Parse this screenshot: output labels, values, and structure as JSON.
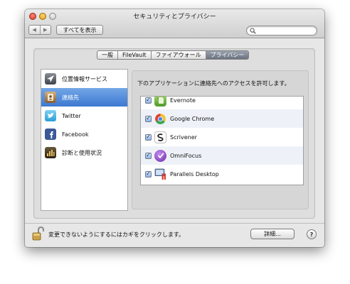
{
  "window": {
    "title": "セキュリティとプライバシー"
  },
  "toolbar": {
    "back_glyph": "◀",
    "forward_glyph": "▶",
    "show_all_label": "すべてを表示",
    "search_placeholder": "",
    "search_value": ""
  },
  "tabs": [
    {
      "label": "一般",
      "active": false
    },
    {
      "label": "FileVault",
      "active": false
    },
    {
      "label": "ファイアウォール",
      "active": false
    },
    {
      "label": "プライバシー",
      "active": true
    }
  ],
  "sidebar": {
    "items": [
      {
        "label": "位置情報サービス",
        "icon": "location-arrow-icon",
        "selected": false
      },
      {
        "label": "連絡先",
        "icon": "contacts-icon",
        "selected": true
      },
      {
        "label": "Twitter",
        "icon": "twitter-icon",
        "selected": false
      },
      {
        "label": "Facebook",
        "icon": "facebook-icon",
        "selected": false
      },
      {
        "label": "診断と使用状況",
        "icon": "diagnostics-icon",
        "selected": false
      }
    ]
  },
  "main": {
    "description": "下のアプリケーションに連絡先へのアクセスを許可します。",
    "apps": [
      {
        "name": "Evernote",
        "checked": true,
        "icon": "evernote-icon"
      },
      {
        "name": "Google Chrome",
        "checked": true,
        "icon": "chrome-icon"
      },
      {
        "name": "Scrivener",
        "checked": true,
        "icon": "scrivener-icon"
      },
      {
        "name": "OmniFocus",
        "checked": true,
        "icon": "omnifocus-icon"
      },
      {
        "name": "Parallels Desktop",
        "checked": true,
        "icon": "parallels-icon"
      }
    ],
    "check_glyph": "✓"
  },
  "footer": {
    "lock_text": "変更できないようにするにはカギをクリックします。",
    "details_label": "詳細...",
    "help_label": "?"
  },
  "colors": {
    "selection": "#3d79d1",
    "window_bg": "#e7e7e7",
    "close": "#d03a2a",
    "minimize": "#d99a14",
    "zoom": "#bdbdbd"
  }
}
